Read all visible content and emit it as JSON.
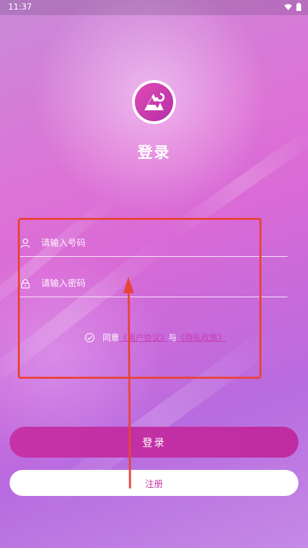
{
  "status_bar": {
    "time": "11:37",
    "icons": [
      "wifi-icon",
      "battery-icon"
    ]
  },
  "header": {
    "logo_icon": "app-logo-icon",
    "title": "登录"
  },
  "form": {
    "phone": {
      "icon": "user-icon",
      "placeholder": "请输入号码",
      "value": ""
    },
    "password": {
      "icon": "lock-icon",
      "placeholder": "请输入密码",
      "value": ""
    },
    "agreement": {
      "icon": "check-circle-icon",
      "prefix": "同意",
      "user_agreement": "《用户协议》",
      "conjunction": "与",
      "privacy_policy": "《隐私政策》"
    }
  },
  "actions": {
    "login_label": "登录",
    "register_label": "注册"
  },
  "colors": {
    "accent": "#c533a8",
    "annotation": "#e8443c"
  }
}
